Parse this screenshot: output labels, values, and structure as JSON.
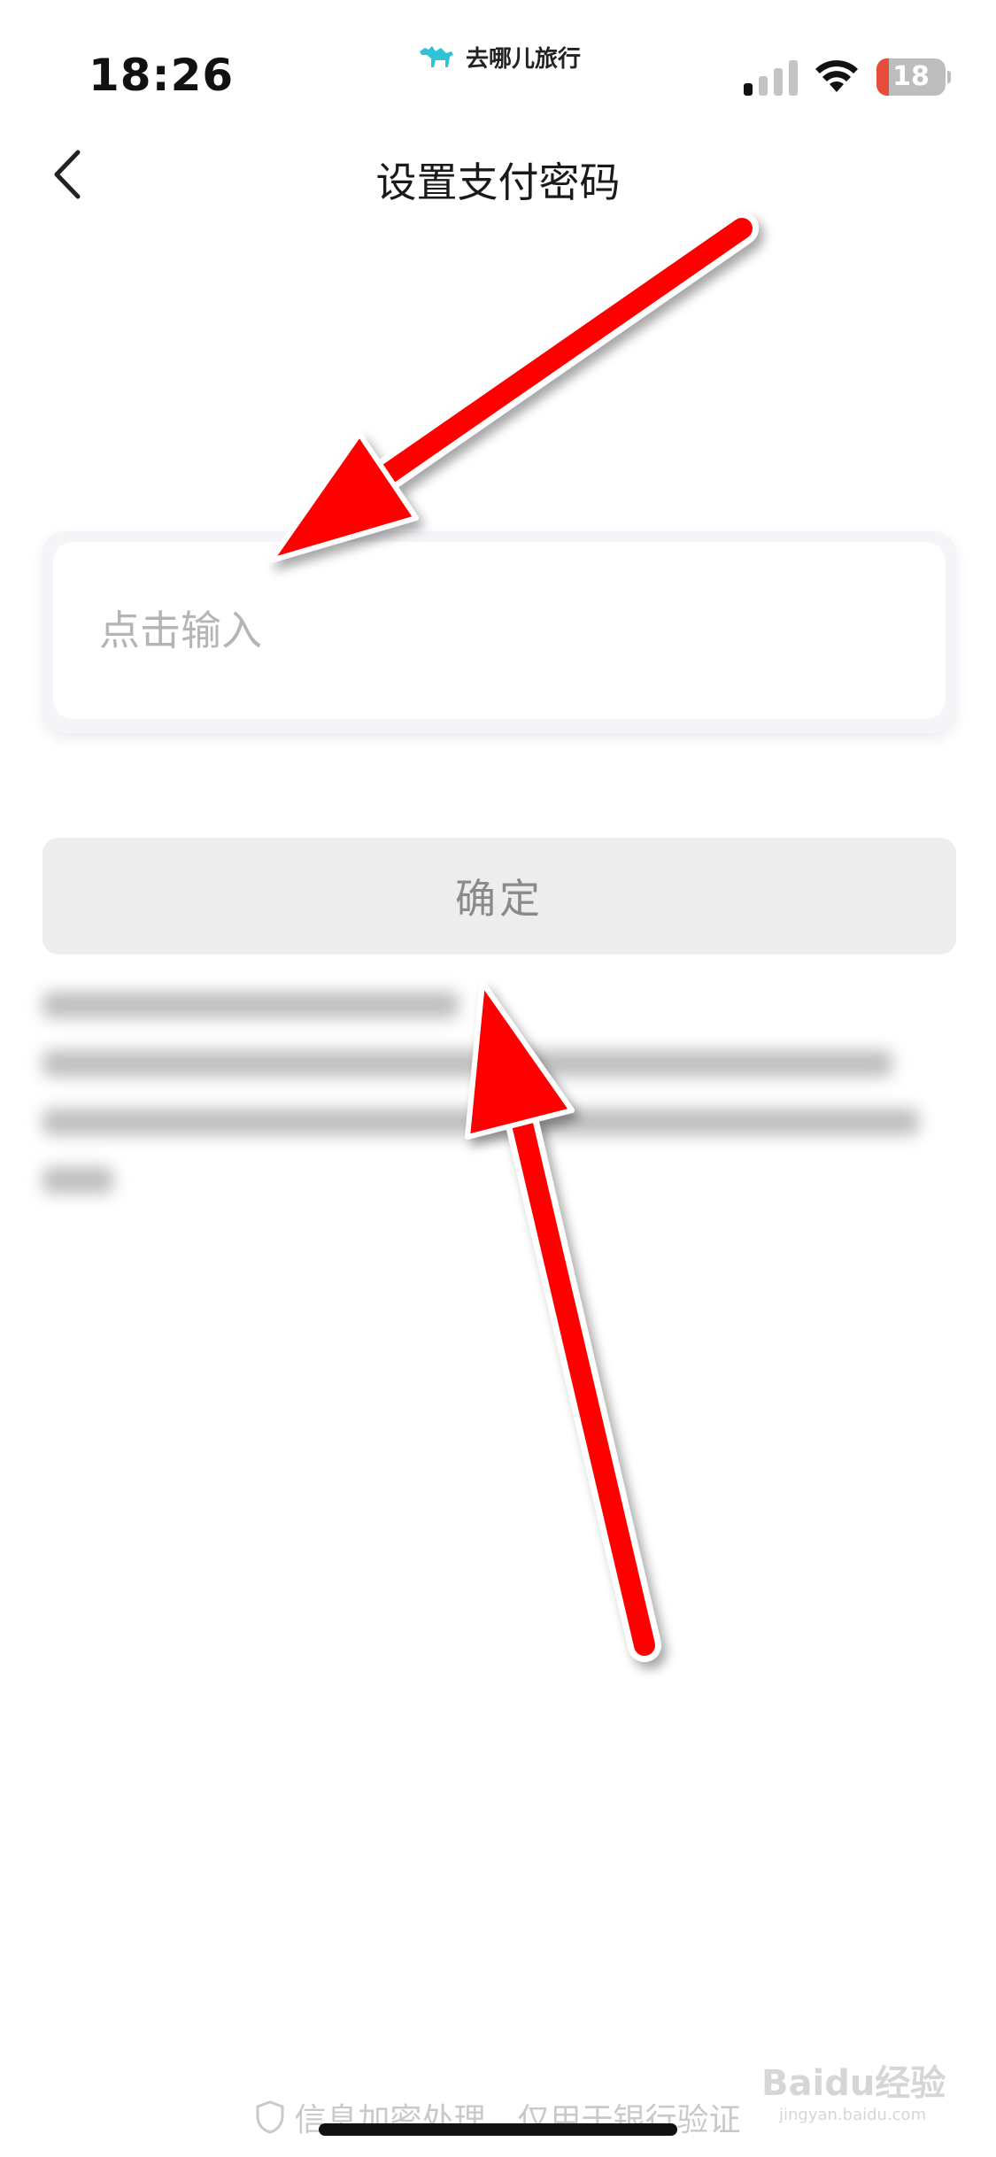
{
  "status_bar": {
    "time": "18:26",
    "brand_name": "去哪儿旅行",
    "battery_level": "18",
    "battery_fraction": 0.18,
    "battery_color": "#e74c3c"
  },
  "nav": {
    "back_icon": "chevron-left-icon",
    "title": "设置支付密码"
  },
  "form": {
    "input_placeholder": "点击输入",
    "input_value": "",
    "confirm_label": "确定"
  },
  "footer": {
    "notice": "信息加密处理，仅用于银行验证",
    "icon": "shield-icon"
  },
  "watermark": {
    "brand": "Baidu经验",
    "url": "jingyan.baidu.com"
  },
  "annotation": {
    "arrow_color": "#ff0000"
  }
}
